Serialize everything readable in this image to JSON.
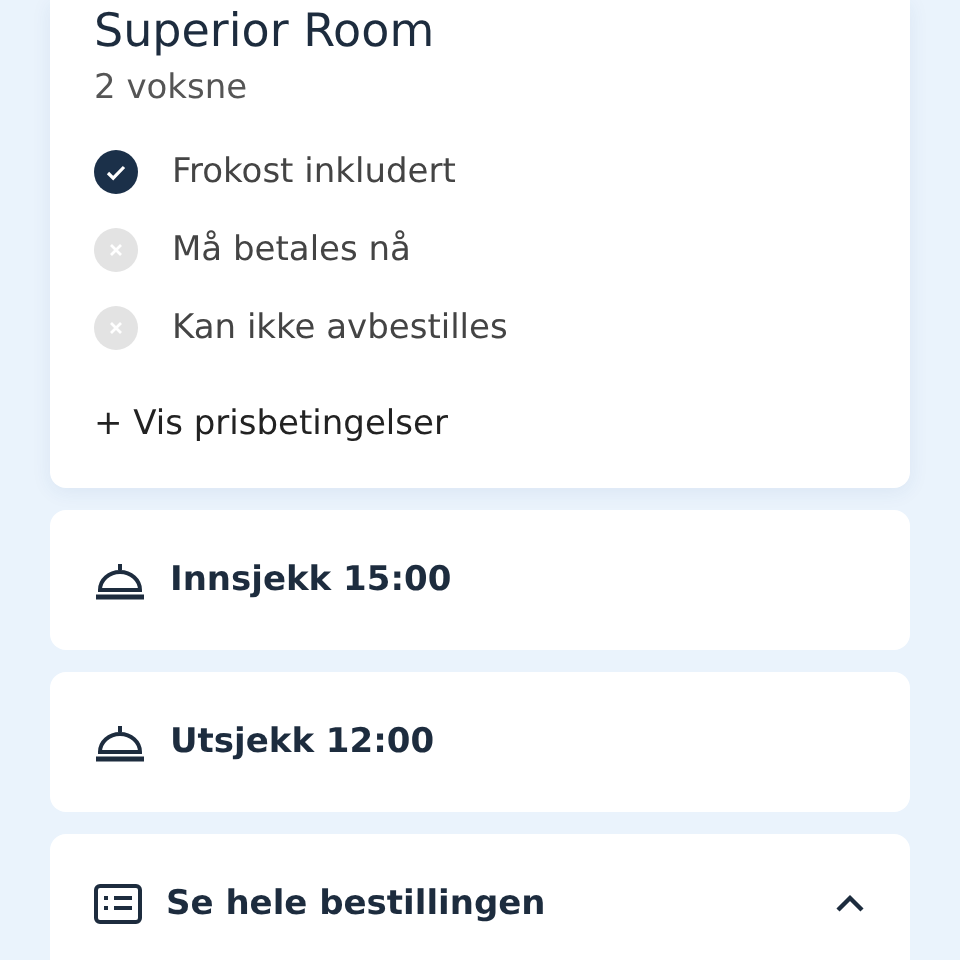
{
  "room": {
    "title": "Superior Room",
    "guests": "2 voksne",
    "features": [
      {
        "label": "Frokost inkludert",
        "included": true
      },
      {
        "label": "Må betales nå",
        "included": false
      },
      {
        "label": "Kan ikke avbestilles",
        "included": false
      }
    ],
    "terms_link": "+ Vis prisbetingelser"
  },
  "rows": [
    {
      "kind": "bell",
      "label": "Innsjekk 15:00"
    },
    {
      "kind": "bell",
      "label": "Utsjekk 12:00"
    },
    {
      "kind": "list",
      "label": "Se hele bestillingen",
      "expanded": true
    }
  ]
}
